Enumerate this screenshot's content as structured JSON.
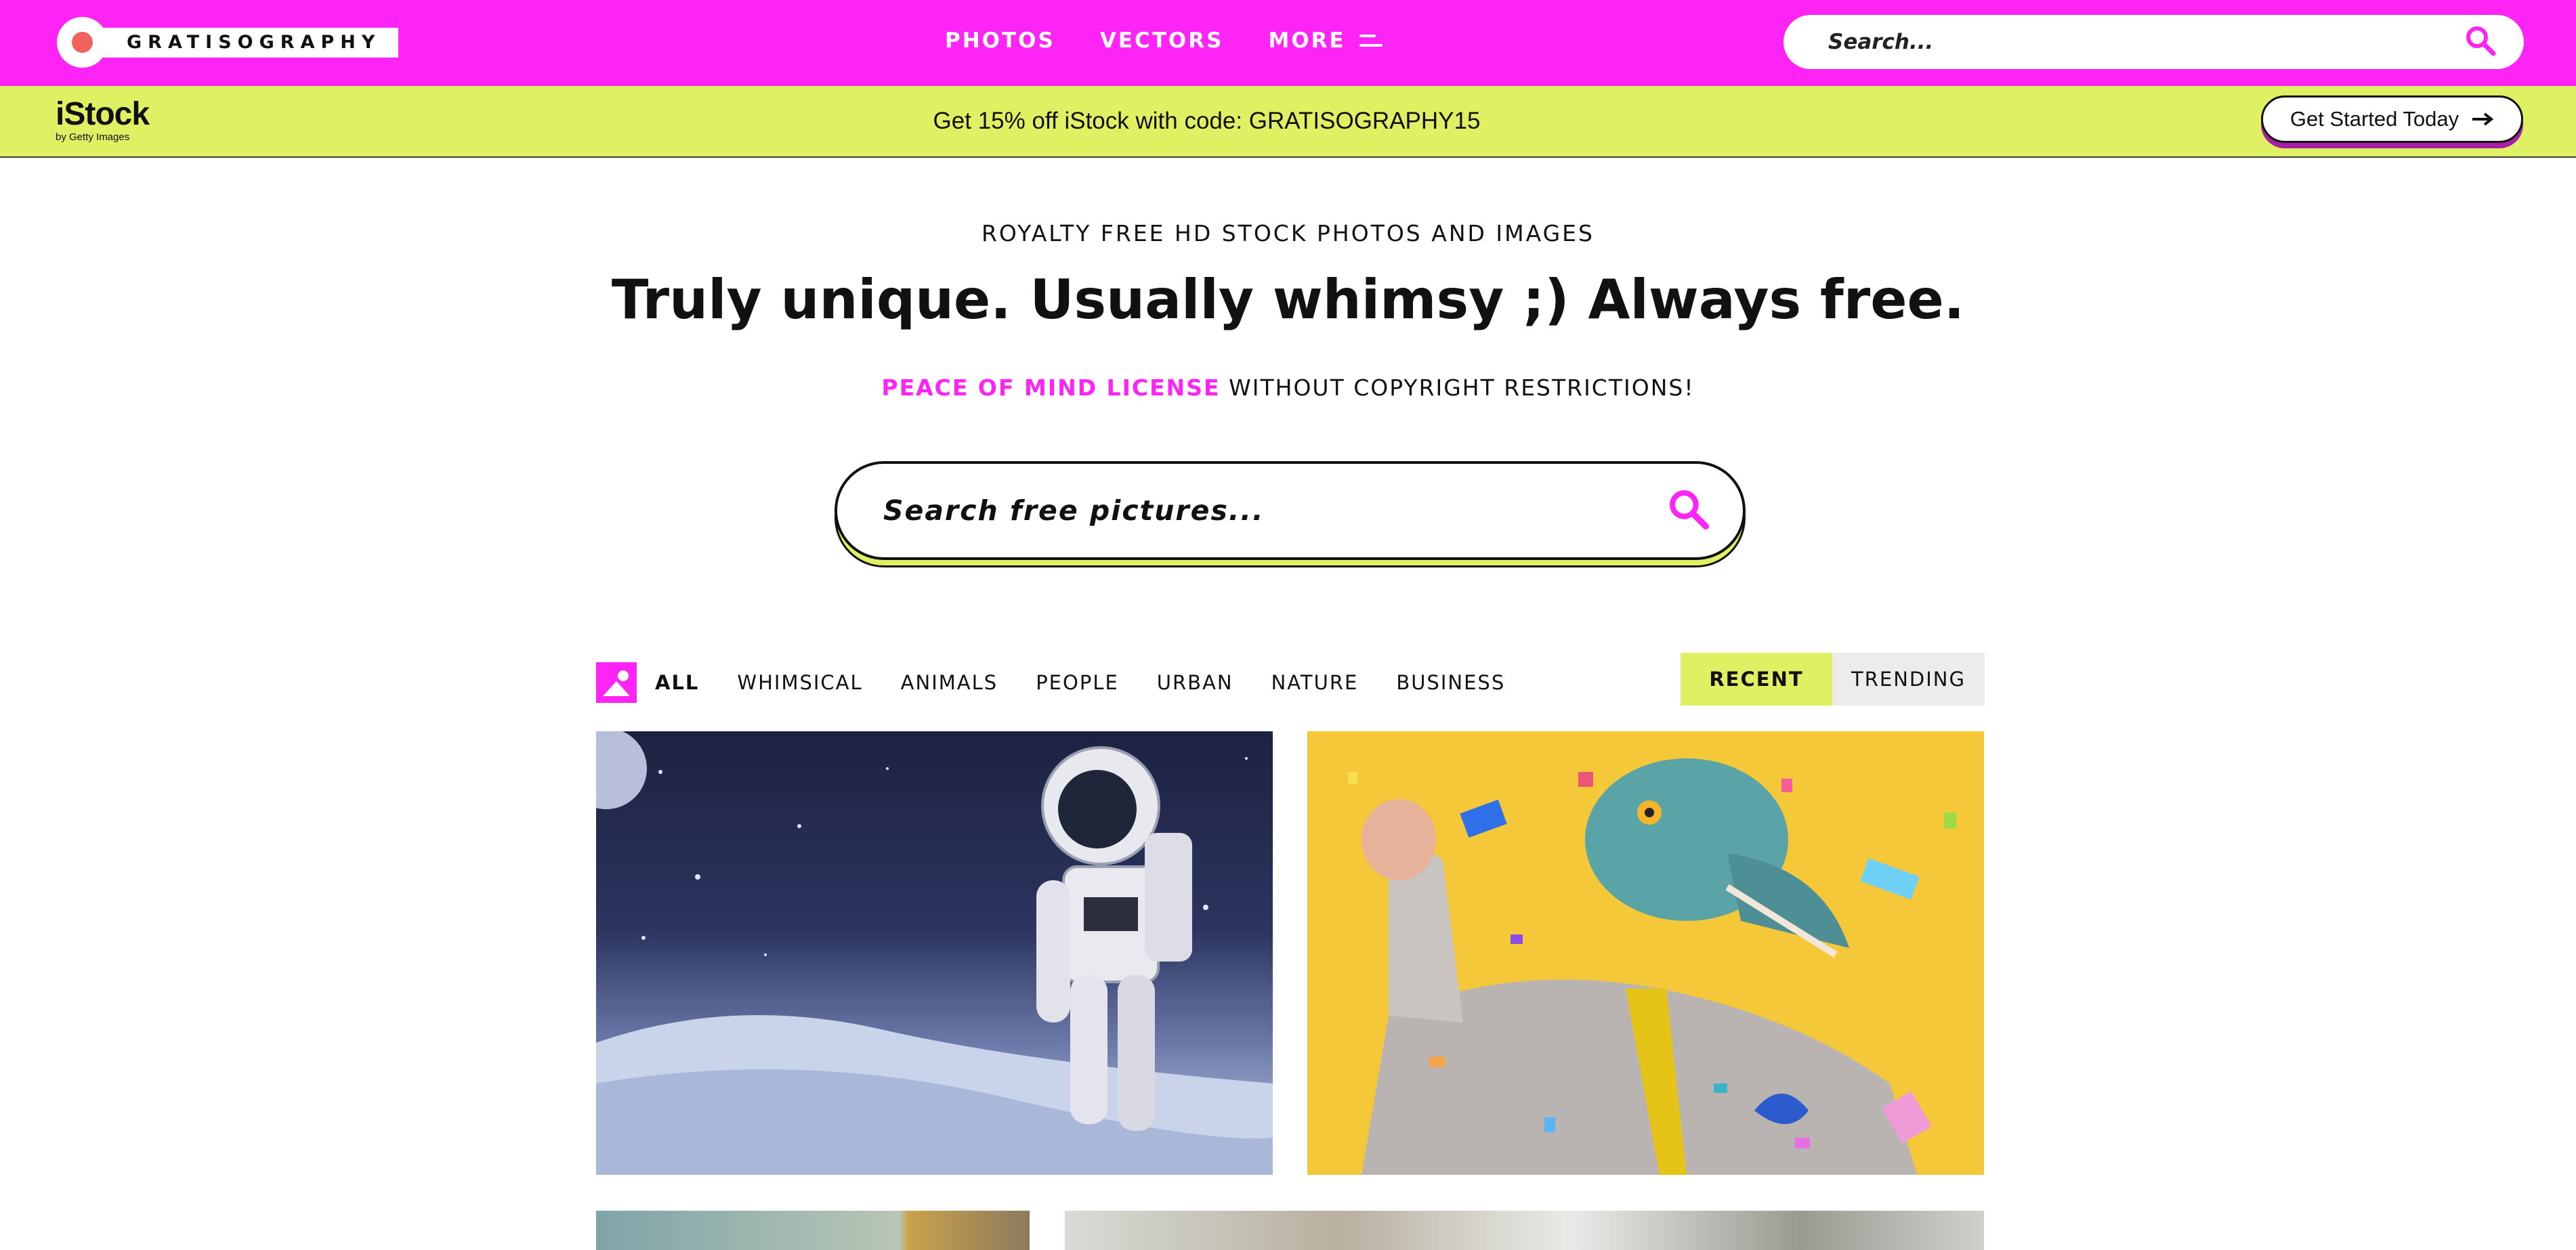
{
  "header": {
    "brand": "GRATISOGRAPHY",
    "nav": [
      {
        "label": "PHOTOS"
      },
      {
        "label": "VECTORS"
      },
      {
        "label": "MORE"
      }
    ],
    "search_placeholder": "Search...",
    "colors": {
      "bar": "#ff24f6",
      "logo_dot": "#f0625c"
    }
  },
  "promo": {
    "istock_brand": "iStock",
    "istock_sub": "by Getty Images",
    "message": "Get 15% off iStock with code: GRATISOGRAPHY15",
    "cta_label": "Get Started Today",
    "colors": {
      "banner": "#dff163",
      "cta_shadow": "#a81ea8"
    }
  },
  "hero": {
    "eyebrow": "ROYALTY FREE HD STOCK PHOTOS AND IMAGES",
    "headline": "Truly unique. Usually whimsy ;) Always free.",
    "license_highlight": "PEACE OF MIND LICENSE",
    "license_rest": "WITHOUT COPYRIGHT RESTRICTIONS!",
    "search_placeholder": "Search free pictures..."
  },
  "filters": {
    "categories": [
      {
        "label": "ALL",
        "active": true
      },
      {
        "label": "WHIMSICAL",
        "active": false
      },
      {
        "label": "ANIMALS",
        "active": false
      },
      {
        "label": "PEOPLE",
        "active": false
      },
      {
        "label": "URBAN",
        "active": false
      },
      {
        "label": "NATURE",
        "active": false
      },
      {
        "label": "BUSINESS",
        "active": false
      }
    ],
    "sort": [
      {
        "label": "RECENT",
        "active": true
      },
      {
        "label": "TRENDING",
        "active": false
      }
    ]
  },
  "photos": [
    {
      "subject": "astronaut-on-moon"
    },
    {
      "subject": "dinosaur-mask-man-confetti"
    },
    {
      "subject": "partial-photo-bottom-left"
    },
    {
      "subject": "partial-photo-bottom-right"
    }
  ]
}
